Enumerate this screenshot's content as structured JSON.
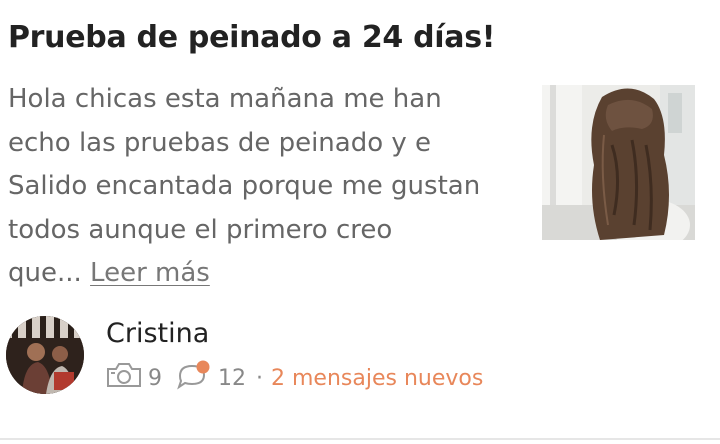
{
  "post": {
    "title": "Prueba de peinado a 24 días!",
    "excerpt_lines": [
      "Hola chicas esta mañana me han",
      "echo las pruebas de peinado y e",
      "Salido encantada porque me gustan",
      "todos  aunque el primero creo",
      "que..."
    ],
    "read_more": "Leer más"
  },
  "author": {
    "name": "Cristina"
  },
  "meta": {
    "photo_icon": "camera-icon",
    "photo_count": "9",
    "comment_icon": "speech-bubble-icon",
    "comment_count": "12",
    "separator": "·",
    "new_messages": "2 mensajes nuevos",
    "accent_color": "#e8875a"
  }
}
